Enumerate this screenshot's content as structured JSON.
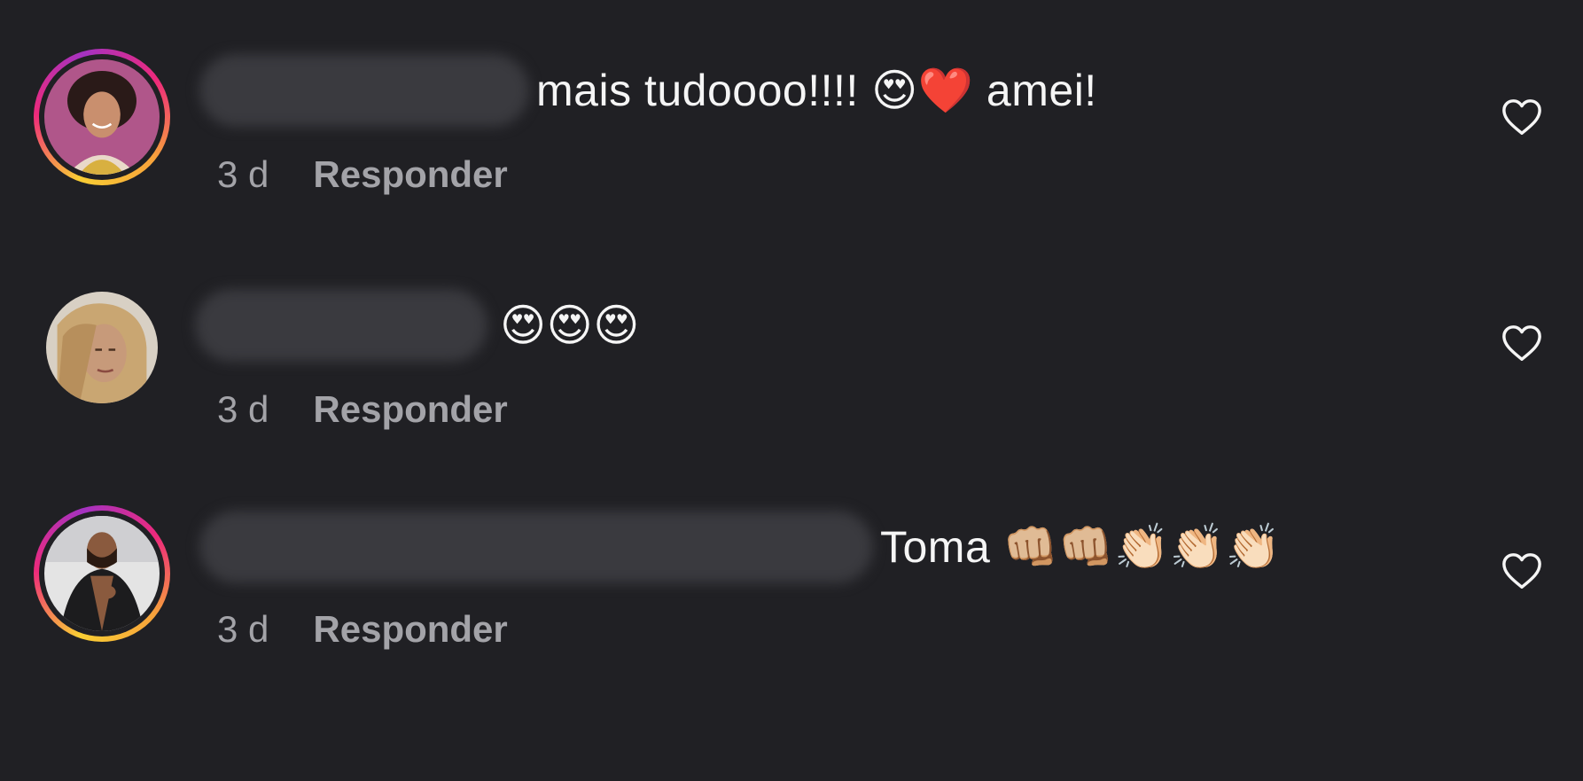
{
  "comments": [
    {
      "text": "mais tudoooo!!!! 😍❤️ amei!",
      "time": "3 d",
      "reply_label": "Responder",
      "has_story_ring": true,
      "avatar": "avatar-photo",
      "like_icon": "heart-outline-icon"
    },
    {
      "text": "😍😍😍",
      "time": "3 d",
      "reply_label": "Responder",
      "has_story_ring": false,
      "avatar": "avatar-photo",
      "like_icon": "heart-outline-icon"
    },
    {
      "text": "Toma 👊🏼👊🏼👏🏻👏🏻👏🏻",
      "time": "3 d",
      "reply_label": "Responder",
      "has_story_ring": true,
      "avatar": "avatar-photo",
      "like_icon": "heart-outline-icon"
    }
  ],
  "colors": {
    "background": "#202024",
    "text": "#f5f5f5",
    "meta_text": "#a3a3a8",
    "ring_gradient": [
      "#f9ce34",
      "#ee2a7b",
      "#a432c2"
    ]
  }
}
